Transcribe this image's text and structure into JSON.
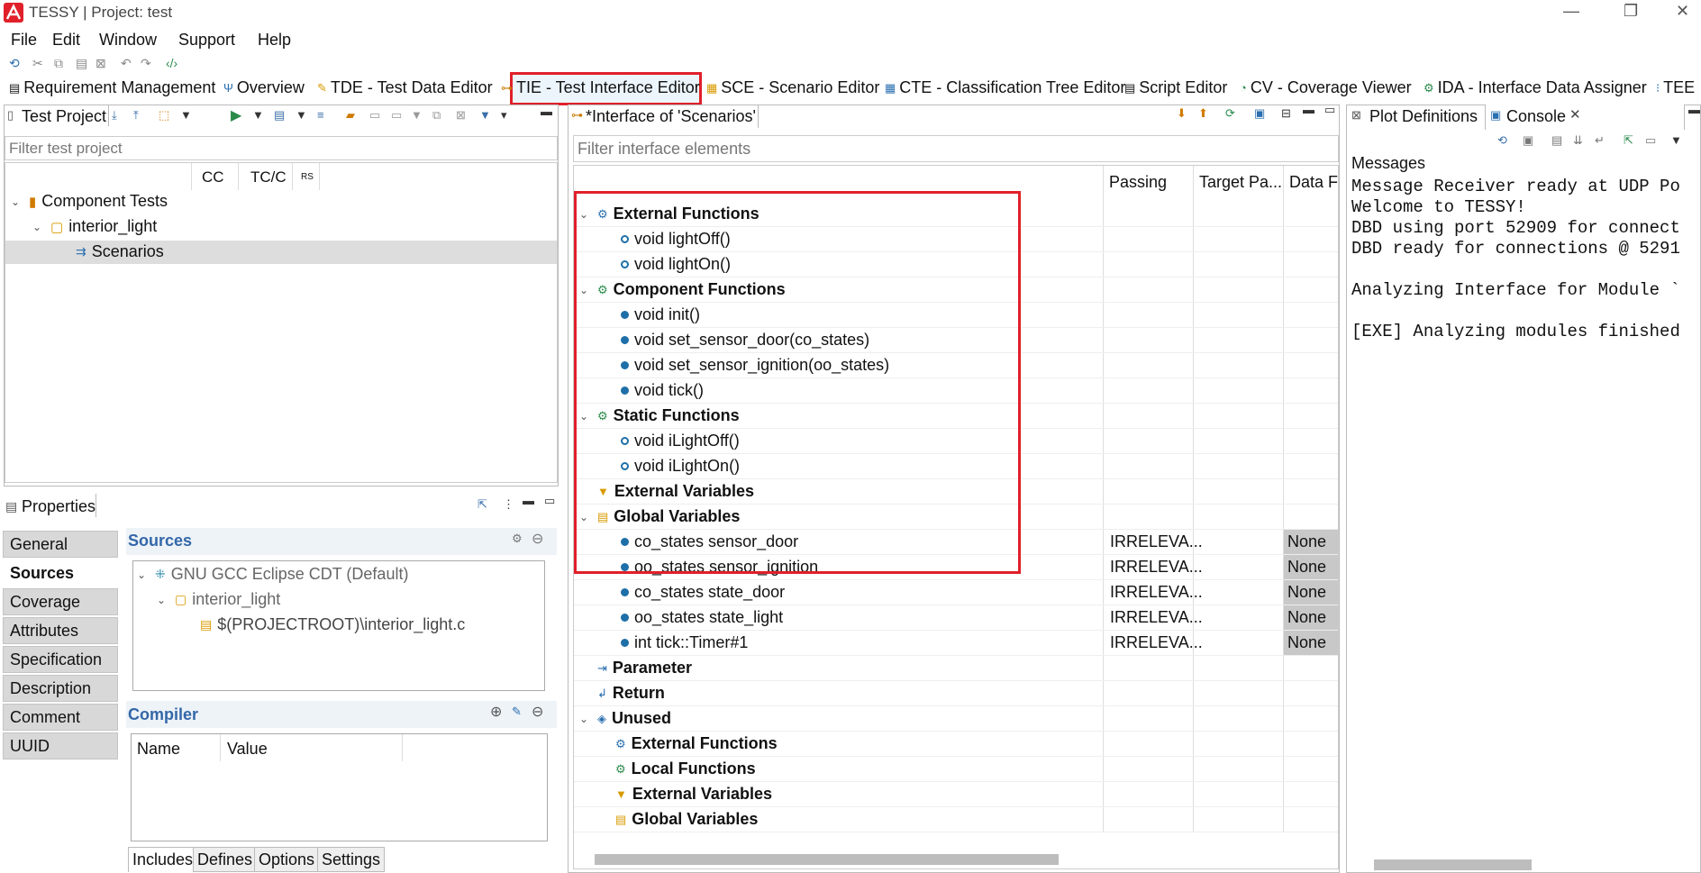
{
  "window": {
    "title": "TESSY | Project: test"
  },
  "menu": [
    "File",
    "Edit",
    "Window",
    "Support",
    "Help"
  ],
  "perspectives": [
    "Requirement Management",
    "Overview",
    "TDE - Test Data Editor",
    "TIE - Test Interface Editor",
    "SCE - Scenario Editor",
    "CTE - Classification Tree Editor",
    "Script Editor",
    "CV - Coverage Viewer",
    "IDA - Interface Data Assigner",
    "TEE"
  ],
  "colors": {
    "accent": "#3367a8",
    "highlight": "#e0202a",
    "status_blue": "#1e6fa8"
  },
  "test_project": {
    "tab_title": "Test Project",
    "filter_placeholder": "Filter test project",
    "columns": [
      "CC",
      "TC/C",
      "RS"
    ],
    "tree": {
      "root": "Component Tests",
      "module": "interior_light",
      "scenario": "Scenarios"
    }
  },
  "properties": {
    "tab_title": "Properties",
    "side_tabs": [
      "General",
      "Sources",
      "Coverage",
      "Attributes",
      "Specification",
      "Description",
      "Comment",
      "UUID"
    ],
    "active_tab": "Sources",
    "sources_title": "Sources",
    "sources_tree": {
      "compiler": "GNU GCC Eclipse CDT (Default)",
      "module": "interior_light",
      "file": "$(PROJECTROOT)\\interior_light.c"
    },
    "compiler_title": "Compiler",
    "compiler_columns": [
      "Name",
      "Value"
    ],
    "bottom_tabs": [
      "Includes",
      "Defines",
      "Options",
      "Settings"
    ],
    "active_bottom_tab": "Includes"
  },
  "interface": {
    "tab_title": "*Interface of 'Scenarios'",
    "filter_placeholder": "Filter interface elements",
    "columns": [
      "Passing",
      "Target Pa...",
      "Data Fo"
    ],
    "rows": [
      {
        "kind": "group",
        "label": "External Functions",
        "icon": "external-functions-icon",
        "expanded": true
      },
      {
        "kind": "func",
        "label": "void lightOff()",
        "hollow": true
      },
      {
        "kind": "func",
        "label": "void lightOn()",
        "hollow": true
      },
      {
        "kind": "group",
        "label": "Component Functions",
        "icon": "component-functions-icon",
        "expanded": true
      },
      {
        "kind": "func",
        "label": "void init()"
      },
      {
        "kind": "func",
        "label": "void set_sensor_door(co_states)"
      },
      {
        "kind": "func",
        "label": "void set_sensor_ignition(oo_states)"
      },
      {
        "kind": "func",
        "label": "void tick()"
      },
      {
        "kind": "group",
        "label": "Static Functions",
        "icon": "static-functions-icon",
        "expanded": true
      },
      {
        "kind": "func",
        "label": "void iLightOff()",
        "hollow": true
      },
      {
        "kind": "func",
        "label": "void iLightOn()",
        "hollow": true
      },
      {
        "kind": "group",
        "label": "External Variables",
        "icon": "external-variables-icon"
      },
      {
        "kind": "group",
        "label": "Global Variables",
        "icon": "global-variables-icon",
        "expanded": true
      },
      {
        "kind": "var",
        "label": "co_states sensor_door",
        "passing": "IRRELEVA...",
        "data": "None"
      },
      {
        "kind": "var",
        "label": "oo_states sensor_ignition",
        "passing": "IRRELEVA...",
        "data": "None"
      },
      {
        "kind": "var",
        "label": "co_states state_door",
        "passing": "IRRELEVA...",
        "data": "None"
      },
      {
        "kind": "var",
        "label": "oo_states state_light",
        "passing": "IRRELEVA...",
        "data": "None"
      },
      {
        "kind": "var",
        "label": "int tick::Timer#1",
        "passing": "IRRELEVA...",
        "data": "None"
      },
      {
        "kind": "group",
        "label": "Parameter",
        "icon": "parameter-icon"
      },
      {
        "kind": "group",
        "label": "Return",
        "icon": "return-icon"
      },
      {
        "kind": "group",
        "label": "Unused",
        "icon": "unused-icon",
        "expanded": true
      },
      {
        "kind": "subgroup",
        "label": "External Functions",
        "icon": "external-functions-icon"
      },
      {
        "kind": "subgroup",
        "label": "Local Functions",
        "icon": "local-functions-icon"
      },
      {
        "kind": "subgroup",
        "label": "External Variables",
        "icon": "external-variables-icon"
      },
      {
        "kind": "subgroup",
        "label": "Global Variables",
        "icon": "global-variables-icon"
      }
    ]
  },
  "right": {
    "tabs": [
      "Plot Definitions",
      "Console"
    ],
    "active_tab": "Console",
    "messages_label": "Messages",
    "console_lines": [
      "Message Receiver ready at UDP Po",
      "Welcome to TESSY!",
      "DBD using port 52909 for connect",
      "DBD ready for connections @ 5291",
      "",
      "Analyzing Interface for Module `",
      "",
      "[EXE] Analyzing modules finished"
    ]
  }
}
